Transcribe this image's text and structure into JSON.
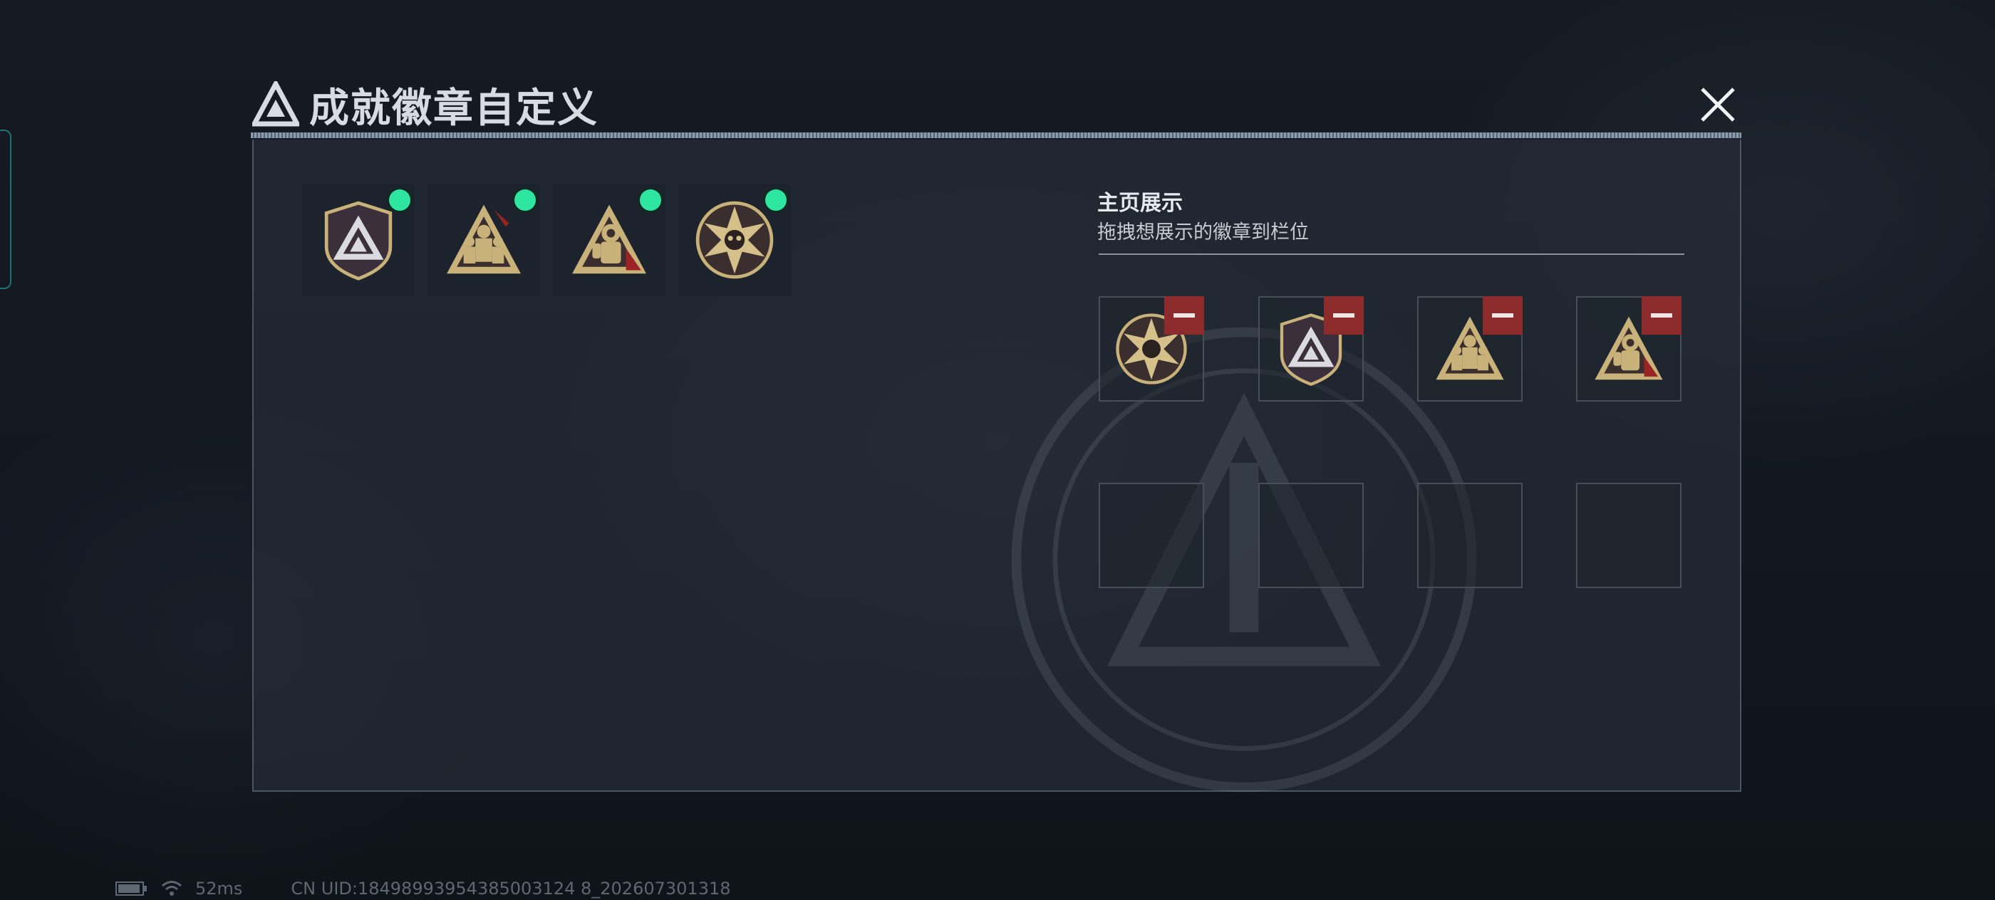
{
  "window": {
    "title": "成就徽章自定义"
  },
  "owned_badges": [
    {
      "icon": "shield-triangle-badge-icon",
      "equipped": true
    },
    {
      "icon": "soldiers-triangle-badge-icon",
      "equipped": true
    },
    {
      "icon": "hazmat-triangle-badge-icon",
      "equipped": true
    },
    {
      "icon": "star-skull-badge-icon",
      "equipped": true
    }
  ],
  "homepage": {
    "title": "主页展示",
    "subtitle": "拖拽想展示的徽章到栏位",
    "slots": [
      {
        "icon": "star-skull-badge-icon",
        "filled": true
      },
      {
        "icon": "shield-triangle-badge-icon",
        "filled": true
      },
      {
        "icon": "soldiers-triangle-badge-icon",
        "filled": true
      },
      {
        "icon": "hazmat-triangle-badge-icon",
        "filled": true
      },
      {
        "filled": false
      },
      {
        "filled": false
      },
      {
        "filled": false
      },
      {
        "filled": false
      }
    ]
  },
  "status_bar": {
    "ping": "52ms",
    "uid": "CN UID:18498993954385003124 8_202607301318"
  },
  "colors": {
    "equipped_dot": "#2ee6a0",
    "remove_button": "#8c2a2c",
    "badge_gold": "#c9b27a"
  }
}
